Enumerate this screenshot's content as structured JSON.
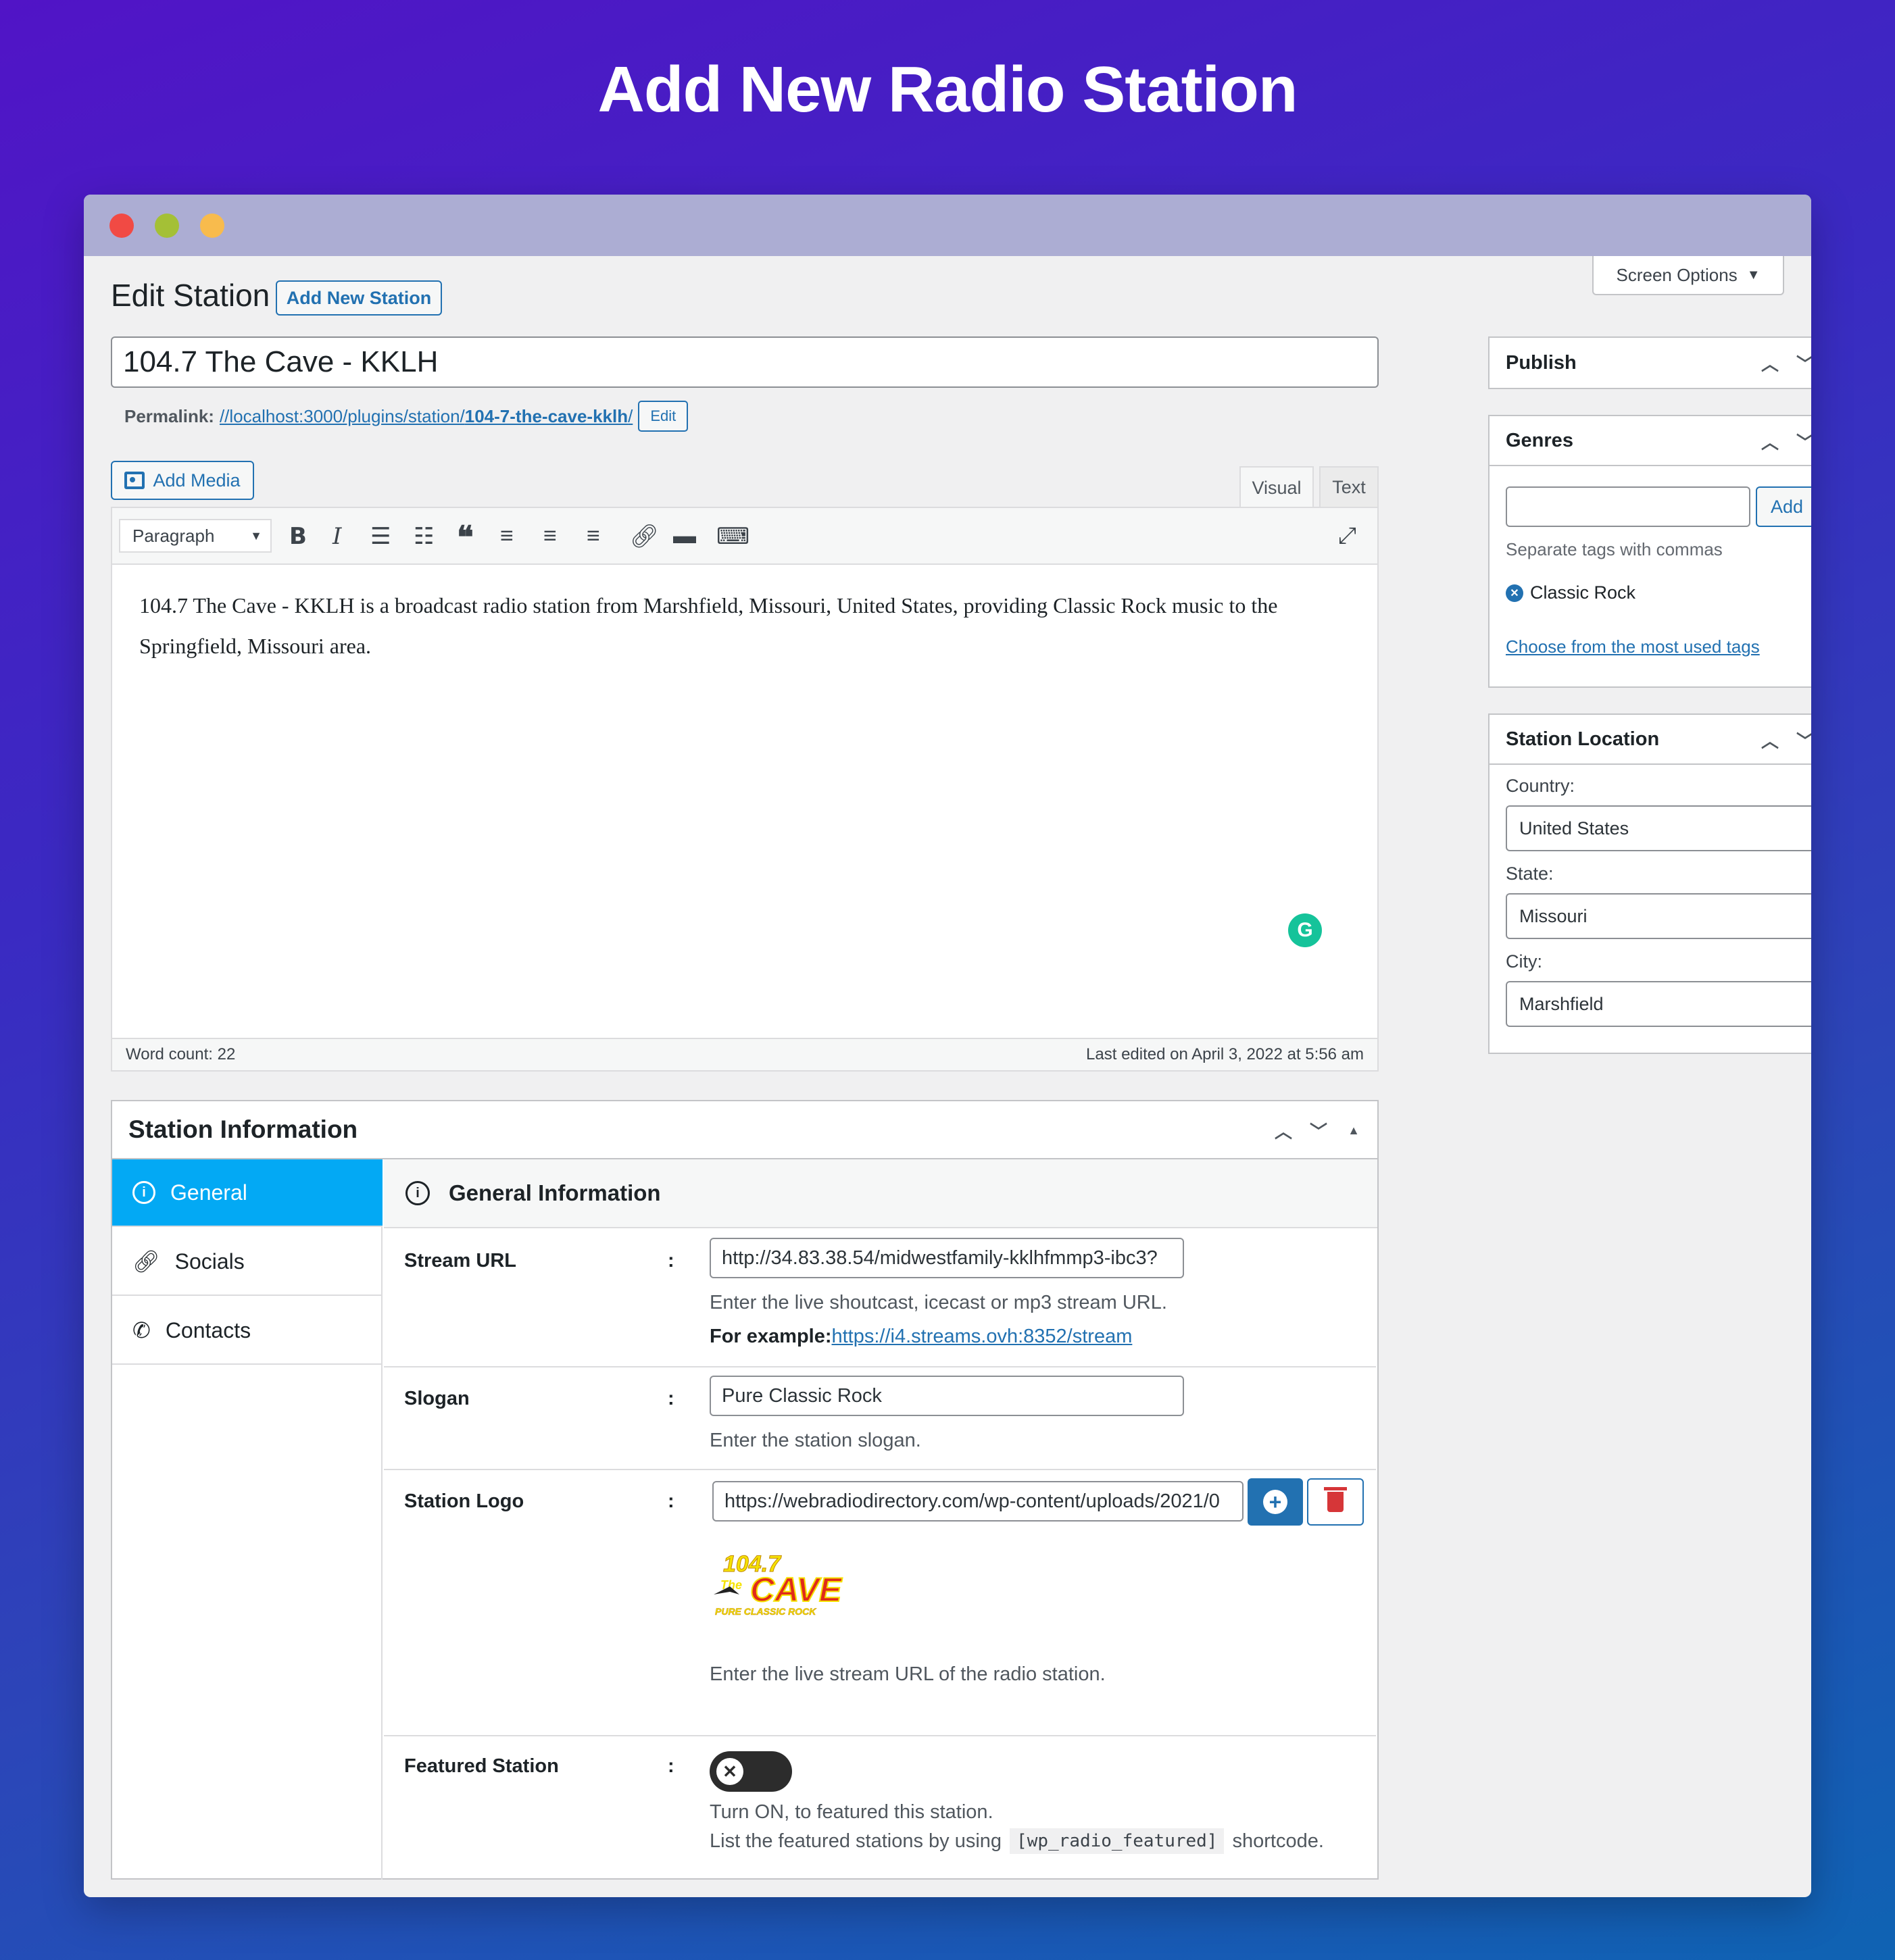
{
  "hero_title": "Add New Radio Station",
  "colors": {
    "close": "#f14a44",
    "minimize": "#a4c036",
    "maximize": "#f8bb4d",
    "accent": "#2271b1",
    "tab_active": "#03a9f4",
    "delete": "#d63638"
  },
  "header": {
    "title": "Edit Station",
    "add_new": "Add New Station",
    "screen_options": "Screen Options"
  },
  "post": {
    "title": "104.7 The Cave - KKLH",
    "permalink_label": "Permalink:",
    "permalink_base": "//localhost:3000/plugins/station/",
    "permalink_slug": "104-7-the-cave-kklh",
    "permalink_end": "/",
    "edit": "Edit"
  },
  "editor": {
    "add_media": "Add Media",
    "tab_visual": "Visual",
    "tab_text": "Text",
    "format": "Paragraph",
    "content": "104.7 The Cave - KKLH is a broadcast radio station from Marshfield, Missouri, United States, providing Classic Rock music to the Springfield, Missouri area.",
    "word_count": "Word count: 22",
    "last_edited": "Last edited on April 3, 2022 at 5:56 am"
  },
  "publish": {
    "title": "Publish"
  },
  "genres": {
    "title": "Genres",
    "add": "Add",
    "hint": "Separate tags with commas",
    "tag": "Classic Rock",
    "choose": "Choose from the most used tags"
  },
  "location": {
    "title": "Station Location",
    "country_label": "Country:",
    "country": "United States",
    "state_label": "State:",
    "state": "Missouri",
    "city_label": "City:",
    "city": "Marshfield"
  },
  "station_info": {
    "title": "Station Information",
    "nav": [
      {
        "label": "General",
        "icon": "info-icon"
      },
      {
        "label": "Socials",
        "icon": "link-icon"
      },
      {
        "label": "Contacts",
        "icon": "phone-icon"
      }
    ],
    "section_title": "General Information",
    "stream_label": "Stream URL",
    "stream_value": "http://34.83.38.54/midwestfamily-kklhfmmp3-ibc3?",
    "stream_help": "Enter the live shoutcast, icecast or mp3 stream URL.",
    "example_label": "For example:",
    "example_link": "https://i4.streams.ovh:8352/stream",
    "slogan_label": "Slogan",
    "slogan_value": "Pure Classic Rock",
    "slogan_help": "Enter the station slogan.",
    "logo_label": "Station Logo",
    "logo_value": "https://webradiodirectory.com/wp-content/uploads/2021/0",
    "logo_help": "Enter the live stream URL of the radio station.",
    "logo_text_top": "104.7",
    "logo_text_main": "CAVE",
    "logo_text_the": "The",
    "logo_text_sub": "PURE CLASSIC ROCK",
    "featured_label": "Featured Station",
    "featured_on": false,
    "featured_help1": "Turn ON, to featured this station.",
    "featured_help2a": "List the featured stations by using",
    "featured_code": "[wp_radio_featured]",
    "featured_help2b": "shortcode.",
    "colon": ":"
  }
}
